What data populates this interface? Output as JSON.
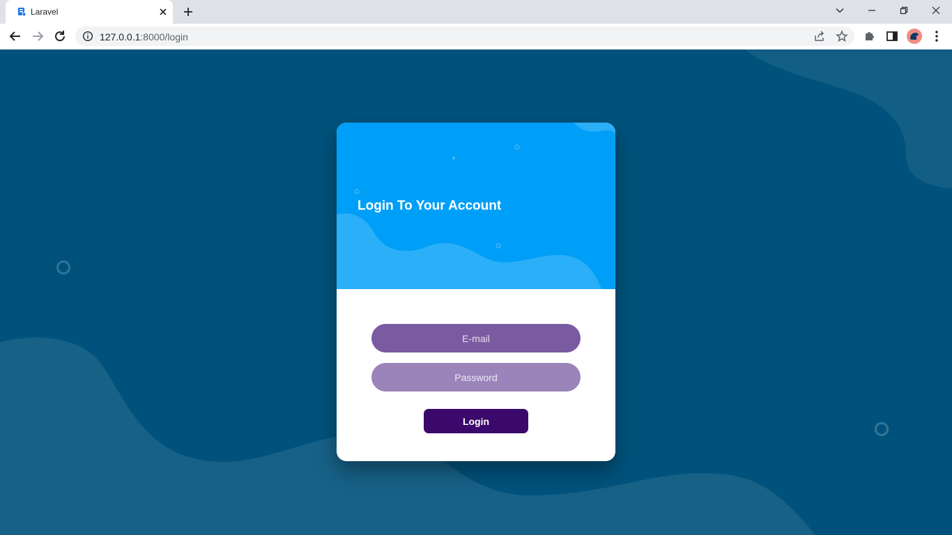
{
  "browser": {
    "tab": {
      "title": "Laravel",
      "favicon": "laravel-page-icon"
    },
    "url": {
      "host": "127.0.0.1",
      "rest": ":8000/login"
    },
    "icons": {
      "back": "arrow-left-icon",
      "forward": "arrow-right-icon",
      "reload": "reload-icon",
      "site_info": "info-icon",
      "share": "share-icon",
      "bookmark": "star-icon",
      "extensions": "puzzle-icon",
      "side_panel": "side-panel-icon",
      "profile": "avatar",
      "menu": "kebab-menu-icon"
    }
  },
  "login": {
    "title": "Login To Your Account",
    "email_placeholder": "E-mail",
    "email_value": "",
    "password_placeholder": "Password",
    "password_value": "",
    "submit_label": "Login"
  },
  "colors": {
    "page_background": "#00527c",
    "card_header": "#009ff7",
    "email_field": "#7a5aa0",
    "password_field": "#9a84ba",
    "login_button": "#3a096b"
  }
}
